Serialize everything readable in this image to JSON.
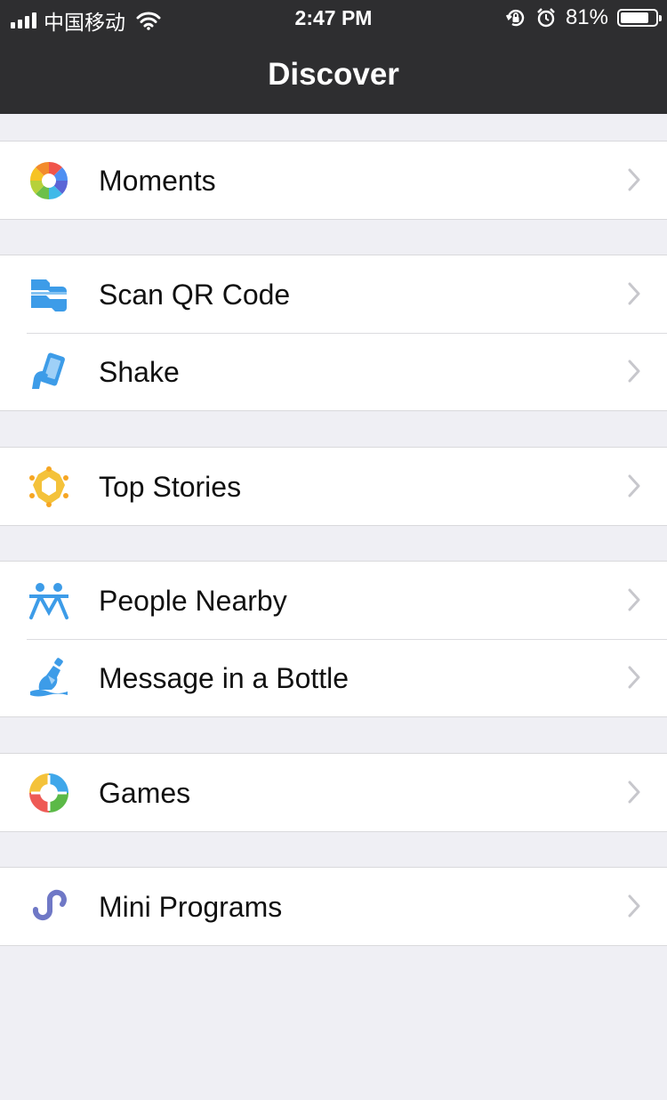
{
  "status_bar": {
    "carrier": "中国移动",
    "time": "2:47 PM",
    "battery": "81%"
  },
  "nav": {
    "title": "Discover"
  },
  "items": {
    "moments": "Moments",
    "scan": "Scan QR Code",
    "shake": "Shake",
    "top_stories": "Top Stories",
    "people_nearby": "People Nearby",
    "bottle": "Message in a Bottle",
    "games": "Games",
    "mini_programs": "Mini Programs"
  },
  "colors": {
    "nav_bar": "#2e2e30",
    "background": "#efeff4",
    "accent_blue": "#3d9ce8",
    "gold": "#f4c23a",
    "purple": "#6f78c6"
  }
}
